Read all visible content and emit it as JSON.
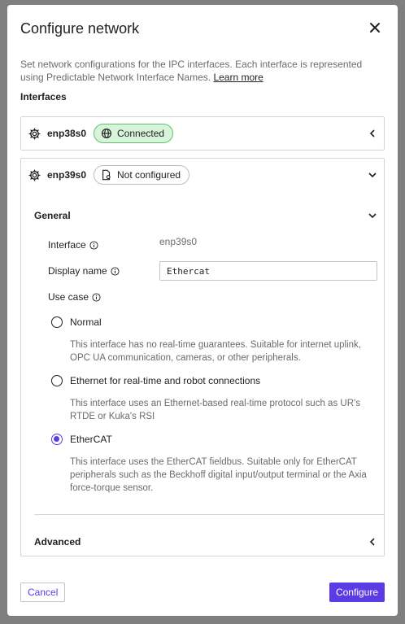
{
  "dialog": {
    "title": "Configure network",
    "description": "Set network configurations for the IPC interfaces. Each interface is represented using Predictable Network Interface Names.",
    "learn_more": "Learn more",
    "interfaces_label": "Interfaces"
  },
  "interfaces": [
    {
      "name": "enp38s0",
      "status": "Connected",
      "expanded": false
    },
    {
      "name": "enp39s0",
      "status": "Not configured",
      "expanded": true
    }
  ],
  "general": {
    "title": "General",
    "interface_label": "Interface",
    "interface_value": "enp39s0",
    "display_name_label": "Display name",
    "display_name_value": "Ethercat",
    "use_case_label": "Use case",
    "options": [
      {
        "label": "Normal",
        "desc": "This interface has no real-time guarantees. Suitable for internet uplink, OPC UA communication, cameras, or other peripherals.",
        "selected": false
      },
      {
        "label": "Ethernet for real-time and robot connections",
        "desc": "This interface uses an Ethernet-based real-time protocol such as UR's RTDE or Kuka's RSI",
        "selected": false
      },
      {
        "label": "EtherCAT",
        "desc": "This interface uses the EtherCAT fieldbus. Suitable only for EtherCAT peripherals such as the Beckhoff digital input/output terminal or the Axia force-torque sensor.",
        "selected": true
      }
    ]
  },
  "advanced": {
    "title": "Advanced"
  },
  "footer": {
    "cancel": "Cancel",
    "configure": "Configure"
  },
  "colors": {
    "accent": "#5b3ce4",
    "connected_bg": "#d8f5dc",
    "connected_border": "#5fbf6e"
  }
}
